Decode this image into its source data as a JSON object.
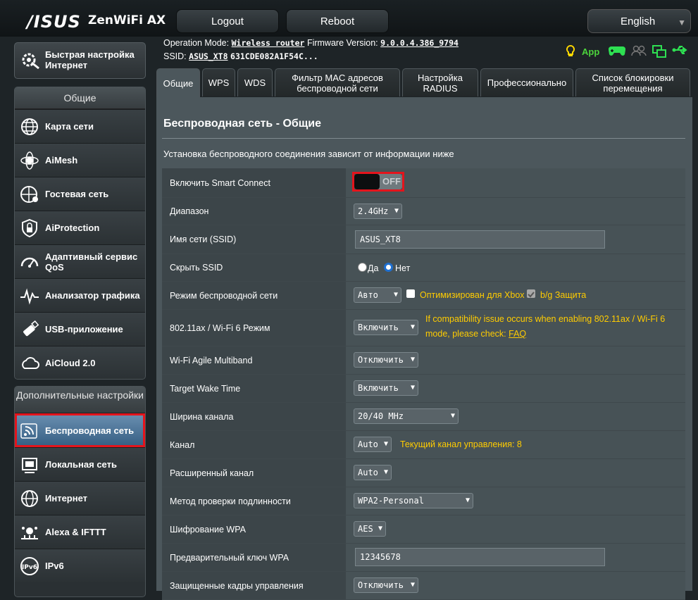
{
  "header": {
    "logo": "/ISUS",
    "product": "ZenWiFi AX",
    "logout_label": "Logout",
    "reboot_label": "Reboot",
    "language": "English"
  },
  "info": {
    "operation_mode_label": "Operation Mode:",
    "operation_mode_value": "Wireless router",
    "firmware_label": "Firmware Version:",
    "firmware_value": "9.0.0.4.386_9794",
    "ssid_label": "SSID:",
    "ssid_value": "ASUS_XT8",
    "ssid_mac": "631CDE082A1F54C...",
    "app_label": "App"
  },
  "sidebar": {
    "quick_setup": "Быстрая настройка Интернет",
    "general_header": "Общие",
    "general_items": [
      {
        "label": "Карта сети",
        "icon": "globe-network-icon"
      },
      {
        "label": "AiMesh",
        "icon": "aimesh-icon"
      },
      {
        "label": "Гостевая сеть",
        "icon": "guest-network-icon"
      },
      {
        "label": "AiProtection",
        "icon": "lock-shield-icon"
      },
      {
        "label": "Адаптивный сервис QoS",
        "icon": "speedometer-icon"
      },
      {
        "label": "Анализатор трафика",
        "icon": "traffic-analyzer-icon"
      },
      {
        "label": "USB-приложение",
        "icon": "usb-icon"
      },
      {
        "label": "AiCloud 2.0",
        "icon": "cloud-icon"
      }
    ],
    "advanced_header": "Дополнительные настройки",
    "advanced_items": [
      {
        "label": "Беспроводная сеть",
        "icon": "wireless-icon"
      },
      {
        "label": "Локальная сеть",
        "icon": "lan-icon"
      },
      {
        "label": "Интернет",
        "icon": "internet-globe-icon"
      },
      {
        "label": "Alexa & IFTTT",
        "icon": "alexa-icon"
      },
      {
        "label": "IPv6",
        "icon": "ipv6-icon"
      }
    ]
  },
  "tabs": [
    {
      "label": "Общие"
    },
    {
      "label": "WPS"
    },
    {
      "label": "WDS"
    },
    {
      "label": "Фильтр MAC адресов беспроводной сети"
    },
    {
      "label": "Настройка RADIUS"
    },
    {
      "label": "Профессионально"
    },
    {
      "label": "Список блокировки перемещения"
    }
  ],
  "content": {
    "title": "Беспроводная сеть - Общие",
    "description": "Установка беспроводного соединения зависит от информации ниже",
    "smart_connect": {
      "label": "Включить Smart Connect",
      "state": "OFF"
    },
    "band": {
      "label": "Диапазон",
      "value": "2.4GHz"
    },
    "ssid": {
      "label": "Имя сети (SSID)",
      "value": "ASUS_XT8"
    },
    "hide_ssid": {
      "label": "Скрыть SSID",
      "yes": "Да",
      "no": "Нет"
    },
    "wireless_mode": {
      "label": "Режим беспроводной сети",
      "value": "Авто",
      "xbox": "Оптимизирован для Xbox",
      "bg": "b/g Защита"
    },
    "ax_mode": {
      "label": "802.11ax / Wi-Fi 6 Режим",
      "value": "Включить",
      "note1": "If compatibility issue occurs when enabling 802.11ax / Wi-Fi 6",
      "note2": "mode, please check:",
      "faq": "FAQ"
    },
    "agile": {
      "label": "Wi-Fi Agile Multiband",
      "value": "Отключить"
    },
    "twt": {
      "label": "Target Wake Time",
      "value": "Включить"
    },
    "bandwidth": {
      "label": "Ширина канала",
      "value": "20/40 MHz"
    },
    "channel": {
      "label": "Канал",
      "value": "Auto",
      "note": "Текущий канал управления: 8"
    },
    "ext_channel": {
      "label": "Расширенный канал",
      "value": "Auto"
    },
    "auth": {
      "label": "Метод проверки подлинности",
      "value": "WPA2-Personal"
    },
    "wpa_enc": {
      "label": "Шифрование WPA",
      "value": "AES"
    },
    "psk": {
      "label": "Предварительный ключ WPA",
      "value": "12345678"
    },
    "pmf": {
      "label": "Защищенные кадры управления",
      "value": "Отключить"
    }
  },
  "colors": {
    "accent_yellow": "#ffcc00",
    "highlight_red": "#e4141c",
    "active_blue": "#345d82"
  }
}
